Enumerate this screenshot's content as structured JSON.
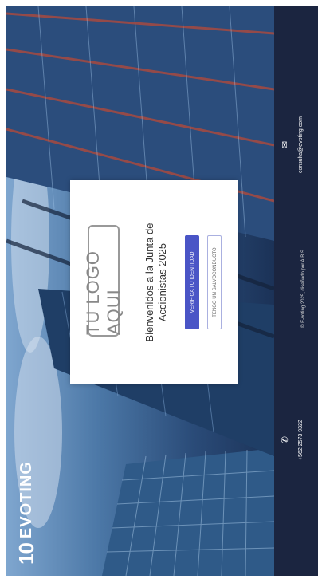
{
  "brand": {
    "mark": "10",
    "name": "EVOTING"
  },
  "card": {
    "logo_placeholder": "TU LOGO AQUI",
    "welcome_line1": "Bienvenidos a la Junta de",
    "welcome_line2": "Accionistas 2025",
    "verify_button": "VERIFICA TU IDENTIDAD",
    "safe_conduct_button": "TENGO UN SALVOCONDUCTO"
  },
  "footer": {
    "phone": "+562 2573 9322",
    "email": "consulta@evoting.com",
    "copyright": "© E-voting 2025, diseñado por A.B.S"
  },
  "icons": {
    "phone": "phone-icon",
    "email": "envelope-icon"
  },
  "colors": {
    "primary_button": "#4a55c6",
    "footer_bg": "#1b2540"
  }
}
